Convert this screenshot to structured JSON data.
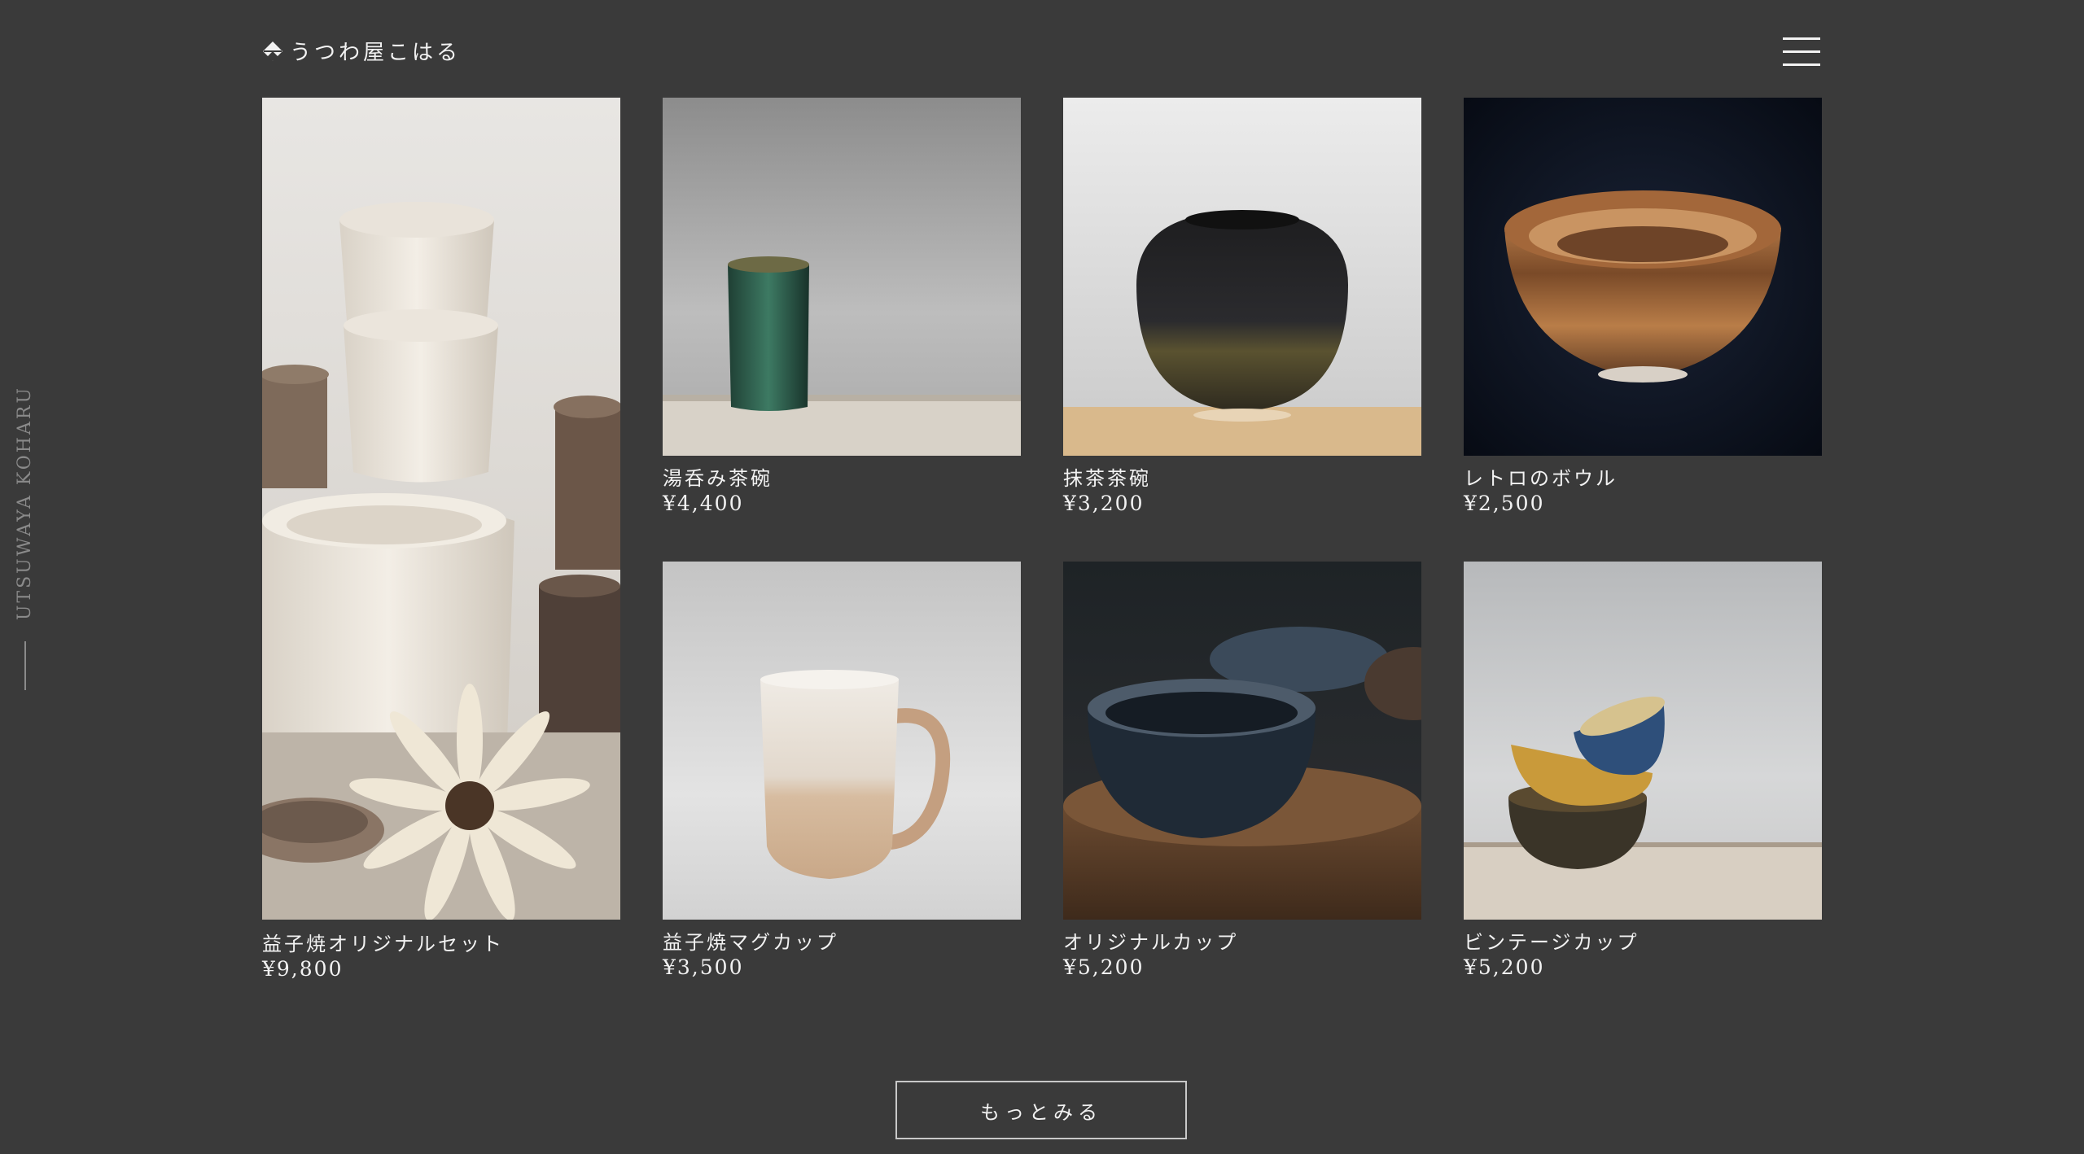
{
  "header": {
    "logo_text": "うつわ屋こはる",
    "logo_icon": "diamond-logo-icon",
    "menu_icon": "hamburger-menu-icon"
  },
  "side": {
    "brand_vertical": "UTSUWAYA KOHARU"
  },
  "products": [
    {
      "name": "益子焼オリジナルセット",
      "price": "¥9,800",
      "image": "speckled-cream-ceramics-set-with-flower"
    },
    {
      "name": "湯呑み茶碗",
      "price": "¥4,400",
      "image": "green-ridged-teacup-on-wood"
    },
    {
      "name": "抹茶茶碗",
      "price": "¥3,200",
      "image": "black-glazed-matcha-bowl"
    },
    {
      "name": "レトロのボウル",
      "price": "¥2,500",
      "image": "brown-striped-bowl-dark-background"
    },
    {
      "name": "益子焼マグカップ",
      "price": "¥3,500",
      "image": "white-and-beige-mug"
    },
    {
      "name": "オリジナルカップ",
      "price": "¥5,200",
      "image": "dark-speckled-bowls-on-wood"
    },
    {
      "name": "ビンテージカップ",
      "price": "¥5,200",
      "image": "stacked-colorful-vintage-cups"
    }
  ],
  "more_button": {
    "label": "もっとみる"
  },
  "colors": {
    "background": "#3a3a3a",
    "text": "#f2f2f2",
    "muted": "#8a8a8a",
    "button_border": "#c8c8c8"
  }
}
